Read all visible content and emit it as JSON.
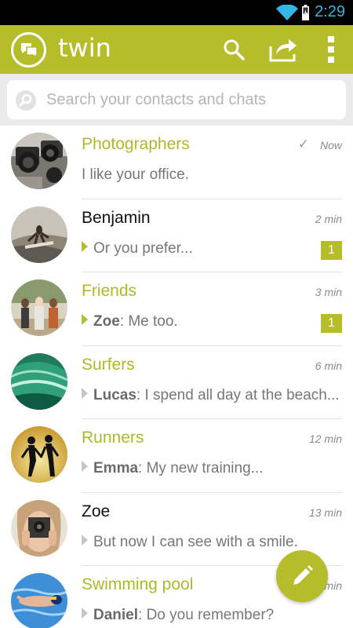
{
  "status_bar": {
    "time": "2:29"
  },
  "app_bar": {
    "title": "twin",
    "logo_icon": "chat-bubbles-icon",
    "actions": [
      "search-icon",
      "share-icon",
      "overflow-menu-icon"
    ]
  },
  "search": {
    "placeholder": "Search your contacts and chats",
    "value": ""
  },
  "colors": {
    "accent": "#b6bd2a",
    "status_bar": "#000000",
    "clock": "#33b5e5"
  },
  "chats": [
    {
      "name": "Photographers",
      "is_group": true,
      "time": "Now",
      "sent_check": true,
      "sender": "",
      "preview": "I like your office.",
      "arrow": "none",
      "unread": ""
    },
    {
      "name": "Benjamin",
      "is_group": false,
      "time": "2 min",
      "sent_check": false,
      "sender": "",
      "preview": "Or you prefer...",
      "arrow": "green",
      "unread": "1"
    },
    {
      "name": "Friends",
      "is_group": true,
      "time": "3 min",
      "sent_check": false,
      "sender": "Zoe",
      "preview": ": Me too.",
      "arrow": "green",
      "unread": "1"
    },
    {
      "name": "Surfers",
      "is_group": true,
      "time": "6 min",
      "sent_check": false,
      "sender": "Lucas",
      "preview": ": I spend all day at the beach...",
      "arrow": "grey",
      "unread": ""
    },
    {
      "name": "Runners",
      "is_group": true,
      "time": "12 min",
      "sent_check": false,
      "sender": "Emma",
      "preview": ": My new training...",
      "arrow": "grey",
      "unread": ""
    },
    {
      "name": "Zoe",
      "is_group": false,
      "time": "13 min",
      "sent_check": false,
      "sender": "",
      "preview": "But now I can see with a smile.",
      "arrow": "grey",
      "unread": ""
    },
    {
      "name": "Swimming pool",
      "is_group": true,
      "time": "14 min",
      "sent_check": false,
      "sender": "Daniel",
      "preview": ": Do you remember?",
      "arrow": "grey",
      "unread": ""
    }
  ],
  "fab": {
    "icon": "pencil-icon"
  }
}
